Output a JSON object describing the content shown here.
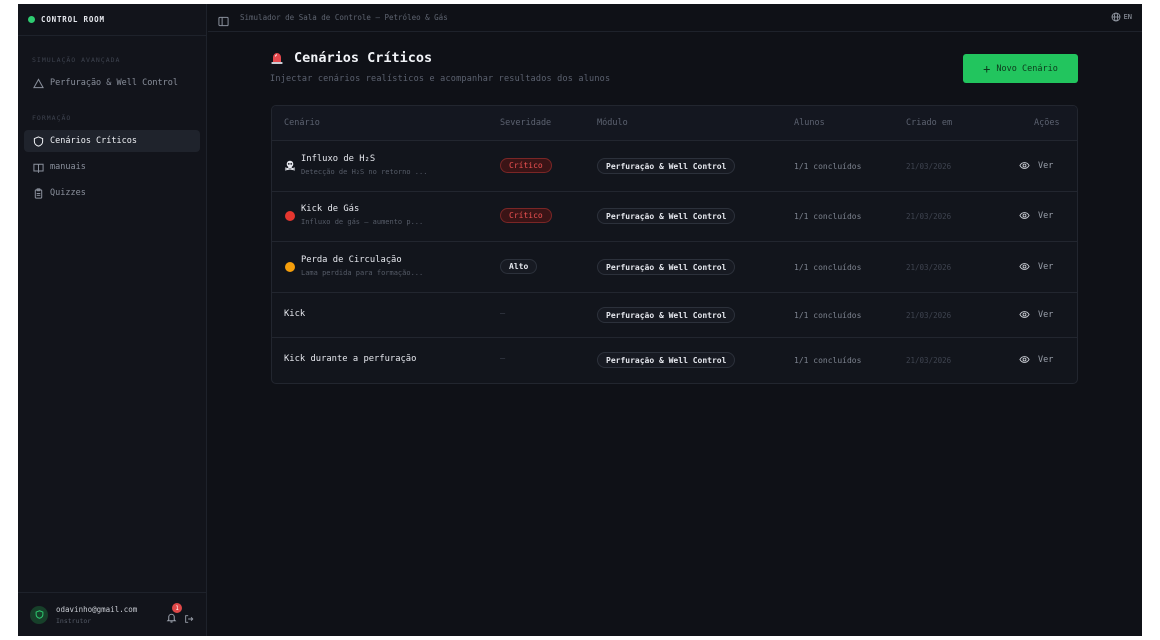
{
  "sidebar": {
    "brand": "CONTROL ROOM",
    "section_sim": "SIMULAÇÃO AVANÇADA",
    "sim_item": "Perfuração & Well Control",
    "section_training": "FORMAÇÃO",
    "items": [
      {
        "label": "Cenários Críticos",
        "icon": "shield-icon"
      },
      {
        "label": "manuais",
        "icon": "book-icon"
      },
      {
        "label": "Quizzes",
        "icon": "clipboard-icon"
      }
    ],
    "user": {
      "email": "odavinho@gmail.com",
      "role": "Instrutor",
      "notifications": "1"
    }
  },
  "topbar": {
    "breadcrumb": "Simulador de Sala de Controle — Petróleo & Gás",
    "language": "EN"
  },
  "page": {
    "title": "Cenários Críticos",
    "subtitle": "Injectar cenários realísticos e acompanhar resultados dos alunos",
    "new_button": "Novo Cenário"
  },
  "table": {
    "headers": {
      "scenario": "Cenário",
      "severity": "Severidade",
      "module": "Módulo",
      "students": "Alunos",
      "created": "Criado em",
      "actions": "Ações"
    },
    "rows": [
      {
        "icon": "skull-icon",
        "name": "Influxo de H₂S",
        "desc": "Detecção de H₂S no retorno ...",
        "severity": "Crítico",
        "module": "Perfuração & Well Control",
        "students": "1/1 concluídos",
        "created": "21/03/2026",
        "action": "Ver"
      },
      {
        "icon": "red-circle-icon",
        "name": "Kick de Gás",
        "desc": "Influxo de gás — aumento p...",
        "severity": "Crítico",
        "module": "Perfuração & Well Control",
        "students": "1/1 concluídos",
        "created": "21/03/2026",
        "action": "Ver"
      },
      {
        "icon": "orange-circle-icon",
        "name": "Perda de Circulação",
        "desc": "Lama perdida para formação...",
        "severity": "Alto",
        "module": "Perfuração & Well Control",
        "students": "1/1 concluídos",
        "created": "21/03/2026",
        "action": "Ver"
      },
      {
        "icon": "",
        "name": "Kick",
        "desc": "",
        "severity": "—",
        "module": "Perfuração & Well Control",
        "students": "1/1 concluídos",
        "created": "21/03/2026",
        "action": "Ver"
      },
      {
        "icon": "",
        "name": "Kick durante a perfuração",
        "desc": "",
        "severity": "—",
        "module": "Perfuração & Well Control",
        "students": "1/1 concluídos",
        "created": "21/03/2026",
        "action": "Ver"
      }
    ]
  },
  "colors": {
    "accent_green": "#22c55e",
    "critical_red": "#f05252",
    "background": "#0f1117"
  }
}
